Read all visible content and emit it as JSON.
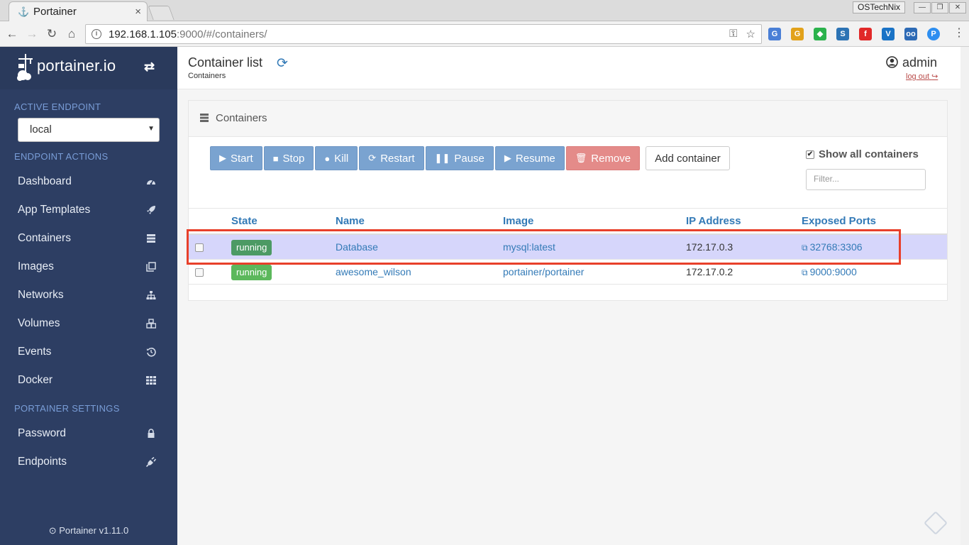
{
  "browser": {
    "tab_title": "Portainer",
    "tab_close": "×",
    "profile": "OSTechNix",
    "url_host": "192.168.1.105",
    "url_rest": ":9000/#/containers/",
    "window_controls": [
      "—",
      "❐",
      "✕"
    ],
    "extensions": [
      {
        "icon": "translate-icon",
        "color": "#4a7fd6",
        "glyph": "G"
      },
      {
        "icon": "google-extension-icon",
        "color": "#e2a21b",
        "glyph": "G"
      },
      {
        "icon": "feedly-icon",
        "color": "#2bb24c",
        "glyph": "◆"
      },
      {
        "icon": "s-extension-icon",
        "color": "#2c73b4",
        "glyph": "S"
      },
      {
        "icon": "flipboard-icon",
        "color": "#e12828",
        "glyph": "f"
      },
      {
        "icon": "vimeo-icon",
        "color": "#1a73c6",
        "glyph": "V"
      },
      {
        "icon": "glasses-icon",
        "color": "#2d6ab5",
        "glyph": "oo"
      },
      {
        "icon": "p-extension-icon",
        "color": "#2d8ef0",
        "glyph": "P"
      }
    ]
  },
  "sidebar": {
    "brand": "portainer.io",
    "active_endpoint_title": "ACTIVE ENDPOINT",
    "endpoint_value": "local",
    "endpoint_actions_title": "ENDPOINT ACTIONS",
    "items": [
      {
        "label": "Dashboard",
        "icon": "dashboard-icon"
      },
      {
        "label": "App Templates",
        "icon": "rocket-icon"
      },
      {
        "label": "Containers",
        "icon": "server-icon"
      },
      {
        "label": "Images",
        "icon": "clone-icon"
      },
      {
        "label": "Networks",
        "icon": "sitemap-icon"
      },
      {
        "label": "Volumes",
        "icon": "cubes-icon"
      },
      {
        "label": "Events",
        "icon": "history-icon"
      },
      {
        "label": "Docker",
        "icon": "th-icon"
      }
    ],
    "settings_title": "PORTAINER SETTINGS",
    "settings_items": [
      {
        "label": "Password",
        "icon": "lock-icon"
      },
      {
        "label": "Endpoints",
        "icon": "plug-icon"
      }
    ],
    "version": "Portainer v1.11.0"
  },
  "header": {
    "title": "Container list",
    "breadcrumb": "Containers",
    "username": "admin",
    "logout": "log out"
  },
  "panel": {
    "title": "Containers",
    "actions": [
      {
        "label": "Start",
        "glyph": "▶",
        "style": "primary"
      },
      {
        "label": "Stop",
        "glyph": "■",
        "style": "primary"
      },
      {
        "label": "Kill",
        "glyph": "●",
        "style": "primary"
      },
      {
        "label": "Restart",
        "glyph": "⟳",
        "style": "primary"
      },
      {
        "label": "Pause",
        "glyph": "❚❚",
        "style": "primary"
      },
      {
        "label": "Resume",
        "glyph": "▶",
        "style": "primary"
      },
      {
        "label": "Remove",
        "glyph": "🗑",
        "style": "danger"
      }
    ],
    "add_container": "Add container",
    "show_all": "Show all containers",
    "filter_placeholder": "Filter...",
    "columns": [
      "State",
      "Name",
      "Image",
      "IP Address",
      "Exposed Ports"
    ],
    "rows": [
      {
        "state": "running",
        "name": "Database",
        "image": "mysql:latest",
        "ip": "172.17.0.3",
        "ports": "32768:3306",
        "selected": true
      },
      {
        "state": "running",
        "name": "awesome_wilson",
        "image": "portainer/portainer",
        "ip": "172.17.0.2",
        "ports": "9000:9000",
        "selected": false
      }
    ]
  },
  "colors": {
    "sidebar_bg": "#2d3e63",
    "accent": "#337ab7",
    "running": "#5cb85c",
    "highlight": "#e8402a"
  }
}
